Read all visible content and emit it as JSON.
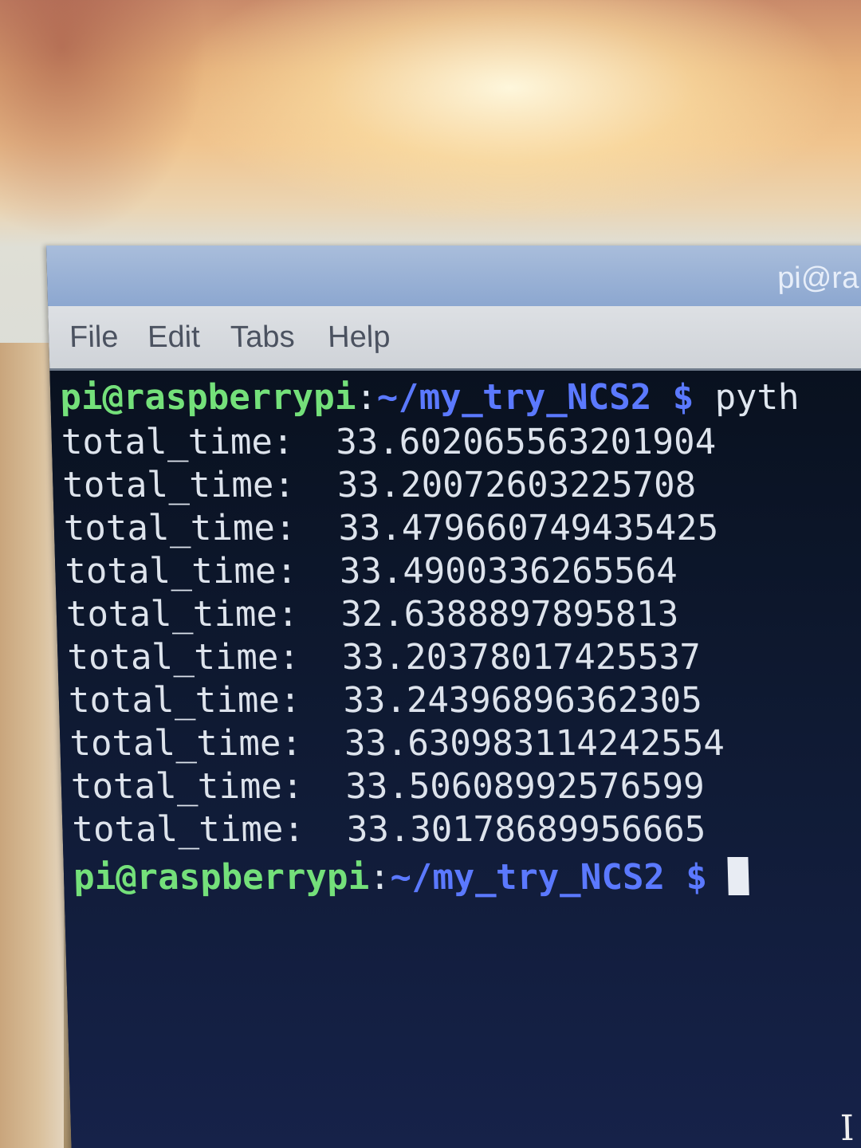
{
  "window": {
    "title": "pi@ra"
  },
  "menu": {
    "items": [
      "File",
      "Edit",
      "Tabs",
      "Help"
    ]
  },
  "terminal": {
    "prompt": {
      "user_host": "pi@raspberrypi",
      "colon": ":",
      "path": "~/my_try_NCS2",
      "dollar": " $ "
    },
    "first_command": "pyth",
    "output_label": "total_time:",
    "output_values": [
      "33.602065563201904",
      "33.20072603225708",
      "33.479660749435425",
      "33.4900336265564",
      "32.6388897895813",
      "33.20378017425537",
      "33.24396896362305",
      "33.630983114242554",
      "33.50608992576599",
      "33.30178689956665"
    ]
  },
  "icons": {
    "cursor": "text-cursor-block",
    "mouse": "ibeam-pointer-icon"
  }
}
